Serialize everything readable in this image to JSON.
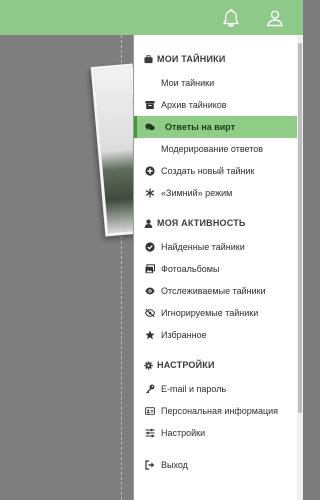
{
  "header": {
    "icons": [
      "bell-icon",
      "user-icon"
    ],
    "background": "#8fc98a"
  },
  "menu": {
    "section_my_caches": "МОИ ТАЙНИКИ",
    "my_caches_items": [
      {
        "label": "Мои тайники",
        "icon": ""
      },
      {
        "label": "Архив тайников",
        "icon": "archive-icon"
      },
      {
        "label": "Ответы на вирт",
        "icon": "comments-icon",
        "active": true
      },
      {
        "label": "Модерирование ответов",
        "icon": ""
      },
      {
        "label": "Создать новый тайник",
        "icon": "plus-circle-icon"
      },
      {
        "label": "«Зимний» режим",
        "icon": "snowflake-icon"
      }
    ],
    "section_activity": "МОЯ АКТИВНОСТЬ",
    "activity_items": [
      {
        "label": "Найденные тайники",
        "icon": "check-circle-icon"
      },
      {
        "label": "Фотоальбомы",
        "icon": "images-icon"
      },
      {
        "label": "Отслеживаемые тайники",
        "icon": "eye-icon"
      },
      {
        "label": "Игнорируемые тайники",
        "icon": "eye-slash-icon"
      },
      {
        "label": "Избранное",
        "icon": "star-icon"
      }
    ],
    "section_settings": "НАСТРОЙКИ",
    "settings_items": [
      {
        "label": "E-mail и пароль",
        "icon": "key-icon"
      },
      {
        "label": "Персональная информация",
        "icon": "id-card-icon"
      },
      {
        "label": "Настройки",
        "icon": "sliders-icon"
      }
    ],
    "logout": {
      "label": "Выход",
      "icon": "sign-out-icon"
    },
    "accent": "#8fcd86"
  }
}
